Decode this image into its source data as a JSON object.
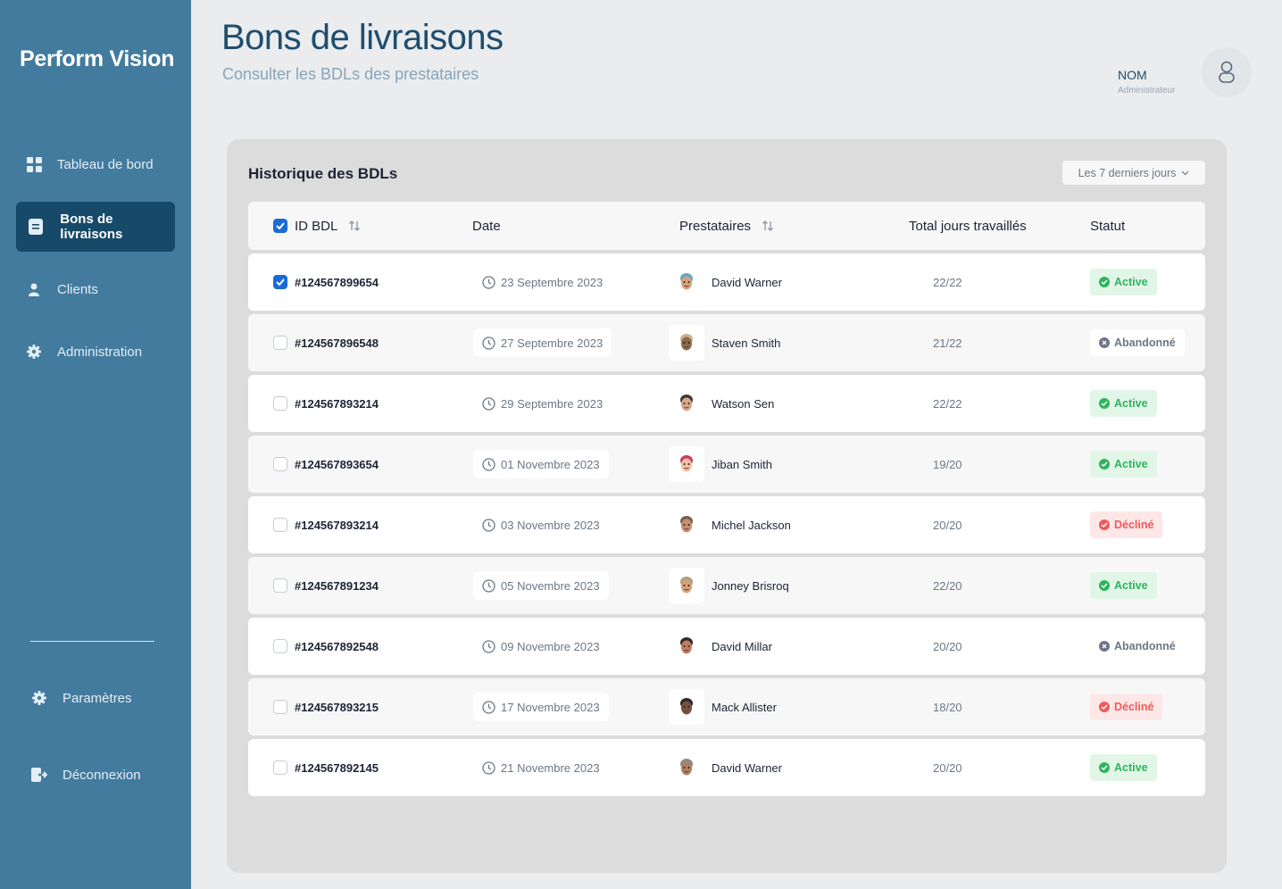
{
  "app": {
    "name": "Perform Vision"
  },
  "sidebar": {
    "items": [
      {
        "label": "Tableau de bord",
        "icon": "dashboard-icon"
      },
      {
        "label": "Bons de livraisons",
        "icon": "document-icon",
        "active": true
      },
      {
        "label": "Clients",
        "icon": "user-icon"
      },
      {
        "label": "Administration",
        "icon": "gear-icon"
      }
    ],
    "bottom_items": [
      {
        "label": "Paramètres",
        "icon": "gear-icon"
      },
      {
        "label": "Déconnexion",
        "icon": "logout-icon"
      }
    ]
  },
  "header": {
    "title": "Bons de livraisons",
    "subtitle": "Consulter les BDLs des prestataires",
    "user_name": "NOM",
    "user_role": "Administrateur"
  },
  "card": {
    "title": "Historique des BDLs",
    "filter_label": "Les 7 derniers jours"
  },
  "table": {
    "columns": {
      "id": "ID BDL",
      "date": "Date",
      "prestataires": "Prestataires",
      "total": "Total jours travaillés",
      "status": "Statut"
    },
    "rows": [
      {
        "id": "#124567899654",
        "date": "23 Septembre 2023",
        "name": "David Warner",
        "total": "22/22",
        "status": "Active",
        "checked": true
      },
      {
        "id": "#124567896548",
        "date": "27 Septembre 2023",
        "name": "Staven Smith",
        "total": "21/22",
        "status": "Abandonné",
        "checked": false
      },
      {
        "id": "#124567893214",
        "date": "29 Septembre 2023",
        "name": "Watson Sen",
        "total": "22/22",
        "status": "Active",
        "checked": false
      },
      {
        "id": "#124567893654",
        "date": "01 Novembre 2023",
        "name": "Jiban Smith",
        "total": "19/20",
        "status": "Active",
        "checked": false
      },
      {
        "id": "#124567893214",
        "date": "03 Novembre 2023",
        "name": "Michel Jackson",
        "total": "20/20",
        "status": "Décliné",
        "checked": false
      },
      {
        "id": "#124567891234",
        "date": "05 Novembre 2023",
        "name": "Jonney Brisroq",
        "total": "22/20",
        "status": "Active",
        "checked": false
      },
      {
        "id": "#124567892548",
        "date": "09 Novembre 2023",
        "name": "David Millar",
        "total": "20/20",
        "status": "Abandonné",
        "checked": false
      },
      {
        "id": "#124567893215",
        "date": "17 Novembre 2023",
        "name": "Mack Allister",
        "total": "18/20",
        "status": "Décliné",
        "checked": false
      },
      {
        "id": "#124567892145",
        "date": "21 Novembre 2023",
        "name": "David Warner",
        "total": "20/20",
        "status": "Active",
        "checked": false
      }
    ]
  },
  "colors": {
    "sidebar": "#437b9e",
    "sidebar_active": "#174a68",
    "status_active": "#2db55d",
    "status_declined": "#ef5a5a",
    "status_abandoned": "#6b7785",
    "checkbox": "#1a6bd6"
  }
}
